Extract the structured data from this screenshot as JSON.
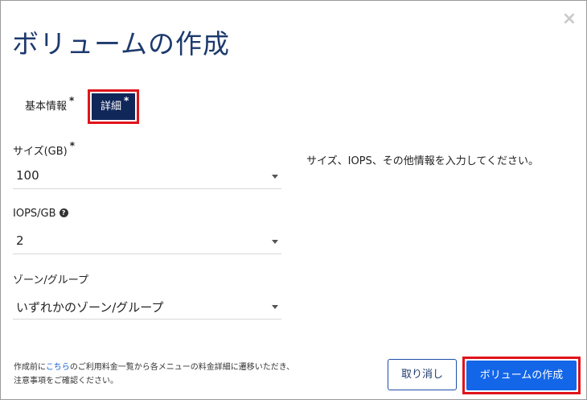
{
  "dialog": {
    "title": "ボリュームの作成",
    "close_icon": "×"
  },
  "tabs": {
    "basic_label": "基本情報",
    "detail_label": "詳細",
    "required_mark": "*"
  },
  "form": {
    "size": {
      "label": "サイズ(GB)",
      "value": "100"
    },
    "iops": {
      "label": "IOPS/GB",
      "help_icon": "?",
      "value": "2"
    },
    "zone": {
      "label": "ゾーン/グループ",
      "value": "いずれかのゾーン/グループ"
    }
  },
  "hint": "サイズ、IOPS、その他情報を入力してください。",
  "footnote": {
    "line1_prefix": "作成前に",
    "link": "こちら",
    "line1_suffix": "のご利用料金一覧から各メニューの料金詳細に遷移いただき、",
    "line2": "注意事項をご確認ください。"
  },
  "buttons": {
    "cancel": "取り消し",
    "create": "ボリュームの作成"
  },
  "colors": {
    "title": "#1d3a6d",
    "active_tab": "#10275a",
    "primary": "#1366e8",
    "highlight": "#e0141b",
    "link": "#1560d6"
  }
}
